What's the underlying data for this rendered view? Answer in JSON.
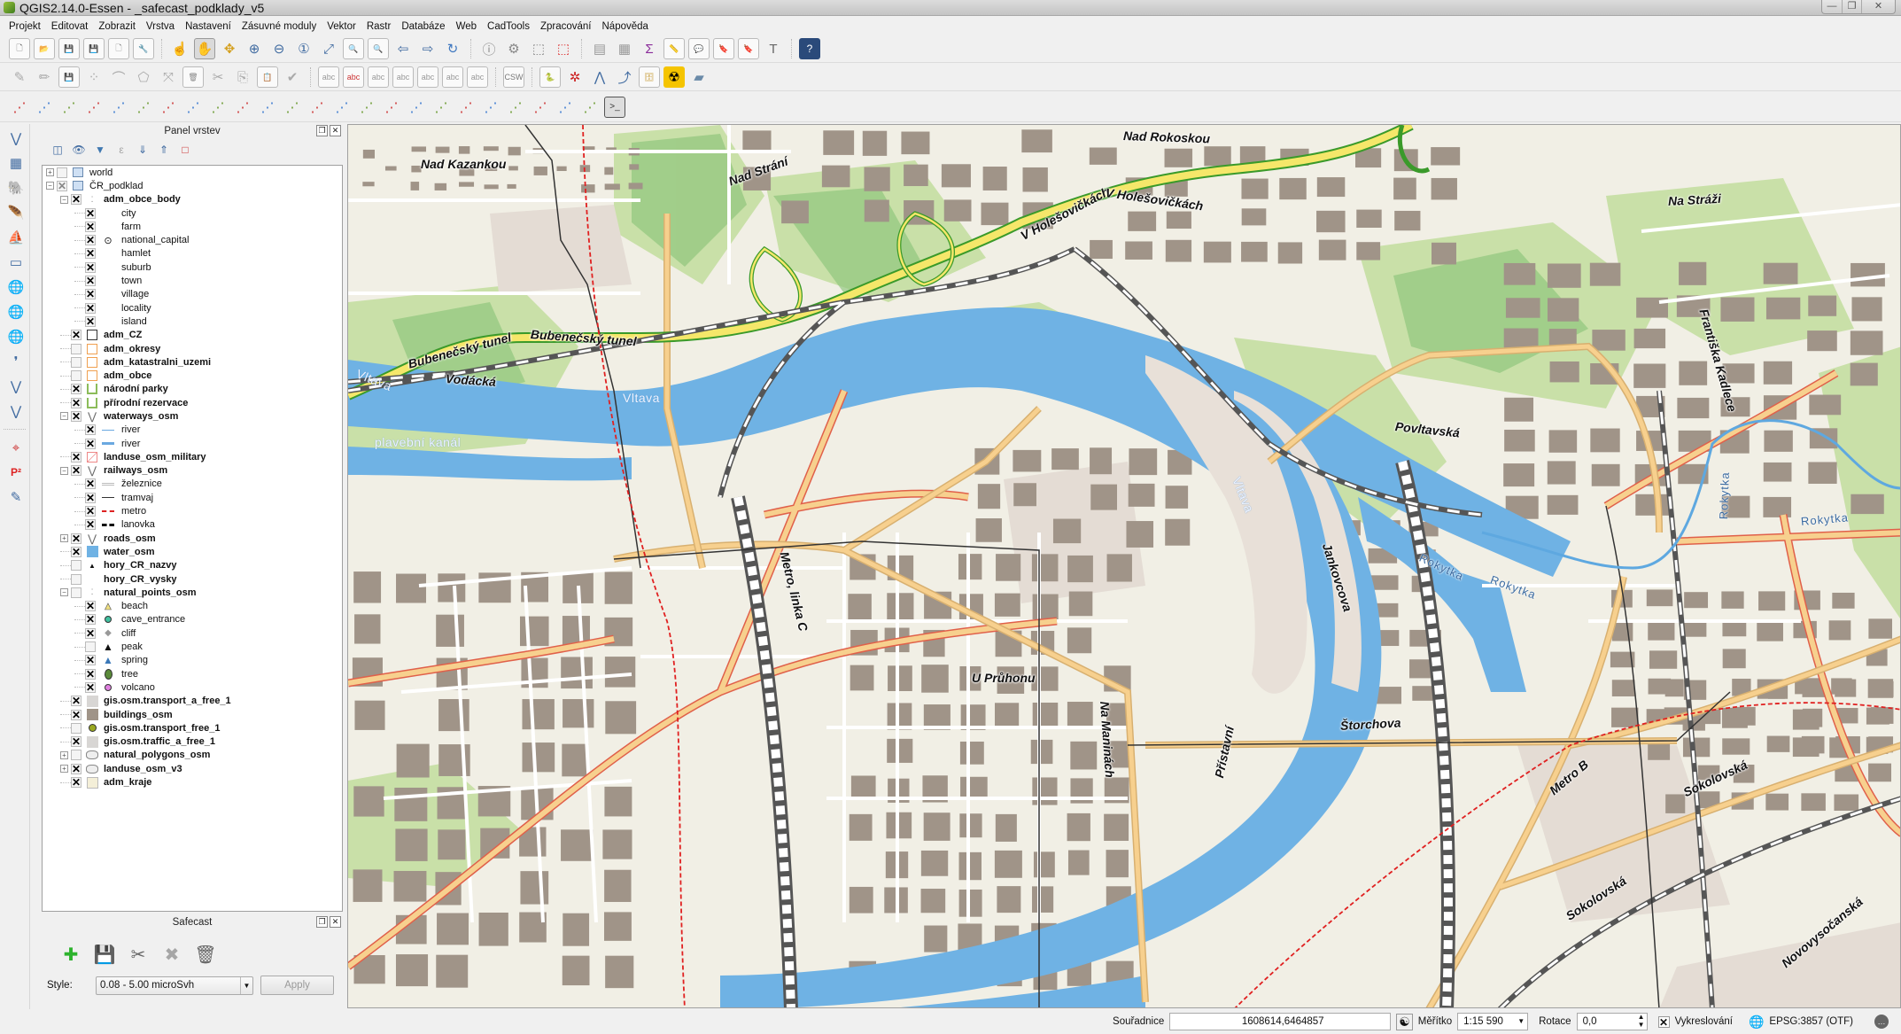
{
  "window": {
    "title": "QGIS2.14.0-Essen - _safecast_podklady_v5",
    "controls": [
      "minimize",
      "restore",
      "close"
    ]
  },
  "menu": [
    "Projekt",
    "Editovat",
    "Zobrazit",
    "Vrstva",
    "Nastavení",
    "Zásuvné moduly",
    "Vektor",
    "Rastr",
    "Databáze",
    "Web",
    "CadTools",
    "Zpracování",
    "Nápověda"
  ],
  "toolbars": {
    "row1": [
      "new-project",
      "open-project",
      "save-project",
      "save-as",
      "new-print-composer",
      "composer-manager",
      "|",
      "touch-zoom",
      "pan",
      "pan-to-selection",
      "zoom-in",
      "zoom-out",
      "zoom-native",
      "zoom-full",
      "zoom-to-selection",
      "zoom-to-layer",
      "zoom-last",
      "zoom-next",
      "refresh",
      "|",
      "identify",
      "action",
      "select",
      "deselect",
      "|",
      "open-attribute-table",
      "field-calculator",
      "statistics",
      "measure",
      "map-tips",
      "new-bookmark",
      "show-bookmarks",
      "text-annotation",
      "|",
      "help"
    ],
    "row2": [
      "current-edits",
      "toggle-editing",
      "save-edits",
      "add-point",
      "node-tool",
      "add-feature",
      "move-feature",
      "delete-selected",
      "cut",
      "copy",
      "paste",
      "digitize",
      "|",
      "label-tool",
      "pin-labels",
      "show-hide-labels",
      "move-label",
      "rotate-label",
      "change-label",
      "label-csw",
      "|",
      "csw",
      "|",
      "python",
      "safecast-tracker",
      "vertex-tool",
      "profile-tool",
      "archive",
      "radiation",
      "polygon"
    ],
    "row3": [
      "cad-1",
      "cad-2",
      "cad-3",
      "cad-4",
      "cad-5",
      "cad-6",
      "cad-7",
      "cad-8",
      "cad-9",
      "cad-10",
      "cad-11",
      "cad-12",
      "cad-13",
      "cad-14",
      "cad-15",
      "cad-16",
      "cad-17",
      "cad-18",
      "cad-19",
      "cad-20",
      "cad-21",
      "cad-22",
      "cad-23",
      "cad-24",
      "python-console"
    ]
  },
  "left_toolbar": [
    "add-vector-layer",
    "add-raster-layer",
    "add-postgis-layer",
    "add-spatialite-layer",
    "add-mssql-layer",
    "add-oracle-layer",
    "add-wms-layer",
    "add-wcs-layer",
    "add-wfs-layer",
    "add-delimited-text",
    "add-virtual-layer",
    "new-shapefile",
    "|",
    "coordinate-capture",
    "p2-plugin",
    "edit-plugin"
  ],
  "layer_panel": {
    "title": "Panel vrstev",
    "layers": [
      {
        "name": "world",
        "level": 0,
        "expand": "+",
        "checked": false,
        "group": false,
        "sym": "group"
      },
      {
        "name": "ČR_podklad",
        "level": 0,
        "expand": "-",
        "checked": "partial",
        "group": false,
        "sym": "group"
      },
      {
        "name": "adm_obce_body",
        "level": 1,
        "expand": "-",
        "checked": true,
        "group": true,
        "sym": "points"
      },
      {
        "name": "city",
        "level": 2,
        "checked": true,
        "sym": ""
      },
      {
        "name": "farm",
        "level": 2,
        "checked": true,
        "sym": ""
      },
      {
        "name": "national_capital",
        "level": 2,
        "checked": true,
        "sym": "capital"
      },
      {
        "name": "hamlet",
        "level": 2,
        "checked": true,
        "sym": ""
      },
      {
        "name": "suburb",
        "level": 2,
        "checked": true,
        "sym": ""
      },
      {
        "name": "town",
        "level": 2,
        "checked": true,
        "sym": ""
      },
      {
        "name": "village",
        "level": 2,
        "checked": true,
        "sym": ""
      },
      {
        "name": "locality",
        "level": 2,
        "checked": true,
        "sym": ""
      },
      {
        "name": "island",
        "level": 2,
        "checked": true,
        "sym": ""
      },
      {
        "name": "adm_CZ",
        "level": 1,
        "checked": true,
        "group": true,
        "sym": "box-black"
      },
      {
        "name": "adm_okresy",
        "level": 1,
        "checked": false,
        "group": true,
        "sym": "box-orange"
      },
      {
        "name": "adm_katastralni_uzemi",
        "level": 1,
        "checked": false,
        "group": true,
        "sym": "box-orange"
      },
      {
        "name": "adm_obce",
        "level": 1,
        "checked": false,
        "group": true,
        "sym": "box-orange"
      },
      {
        "name": "národní parky",
        "level": 1,
        "checked": true,
        "group": true,
        "sym": "box-green"
      },
      {
        "name": "přírodní rezervace",
        "level": 1,
        "checked": true,
        "group": true,
        "sym": "box-green"
      },
      {
        "name": "waterways_osm",
        "level": 1,
        "expand": "-",
        "checked": true,
        "group": true,
        "sym": "line-rule"
      },
      {
        "name": "river",
        "level": 2,
        "checked": true,
        "sym": "line-blue-thin"
      },
      {
        "name": "river",
        "level": 2,
        "checked": true,
        "sym": "line-blue-thick"
      },
      {
        "name": "landuse_osm_military",
        "level": 1,
        "checked": true,
        "group": true,
        "sym": "box-hatch"
      },
      {
        "name": "railways_osm",
        "level": 1,
        "expand": "-",
        "checked": true,
        "group": true,
        "sym": "line-rule"
      },
      {
        "name": "železnice",
        "level": 2,
        "checked": true,
        "sym": "line-grey"
      },
      {
        "name": "tramvaj",
        "level": 2,
        "checked": true,
        "sym": "line-tram"
      },
      {
        "name": "metro",
        "level": 2,
        "checked": true,
        "sym": "line-red-dash"
      },
      {
        "name": "lanovka",
        "level": 2,
        "checked": true,
        "sym": "line-black-dash"
      },
      {
        "name": "roads_osm",
        "level": 1,
        "expand": "+",
        "checked": true,
        "group": true,
        "sym": "line-rule"
      },
      {
        "name": "water_osm",
        "level": 1,
        "checked": true,
        "group": true,
        "sym": "fill-blue"
      },
      {
        "name": "hory_CR_nazvy",
        "level": 1,
        "checked": false,
        "group": true,
        "sym": "triangle-small"
      },
      {
        "name": "hory_CR_vysky",
        "level": 1,
        "checked": false,
        "group": true,
        "sym": ""
      },
      {
        "name": "natural_points_osm",
        "level": 1,
        "expand": "-",
        "checked": false,
        "group": true,
        "sym": "points"
      },
      {
        "name": "beach",
        "level": 2,
        "checked": true,
        "sym": "tri-yellow"
      },
      {
        "name": "cave_entrance",
        "level": 2,
        "checked": true,
        "sym": "dot-teal"
      },
      {
        "name": "cliff",
        "level": 2,
        "checked": true,
        "sym": "diamond-grey"
      },
      {
        "name": "peak",
        "level": 2,
        "checked": false,
        "sym": "tri-black"
      },
      {
        "name": "spring",
        "level": 2,
        "checked": true,
        "sym": "tri-blue"
      },
      {
        "name": "tree",
        "level": 2,
        "checked": true,
        "sym": "ellipse-green"
      },
      {
        "name": "volcano",
        "level": 2,
        "checked": true,
        "sym": "dot-pink"
      },
      {
        "name": "gis.osm.transport_a_free_1",
        "level": 1,
        "checked": true,
        "group": true,
        "sym": "fill-lightgrey"
      },
      {
        "name": "buildings_osm",
        "level": 1,
        "checked": true,
        "group": true,
        "sym": "fill-brown"
      },
      {
        "name": "gis.osm.transport_free_1",
        "level": 1,
        "checked": false,
        "group": true,
        "sym": "dot-olive"
      },
      {
        "name": "gis.osm.traffic_a_free_1",
        "level": 1,
        "checked": true,
        "group": true,
        "sym": "fill-lightgrey"
      },
      {
        "name": "natural_polygons_osm",
        "level": 1,
        "expand": "+",
        "checked": false,
        "group": true,
        "sym": "poly-rule"
      },
      {
        "name": "landuse_osm_v3",
        "level": 1,
        "expand": "+",
        "checked": true,
        "group": true,
        "sym": "poly-rule"
      },
      {
        "name": "adm_kraje",
        "level": 1,
        "checked": true,
        "group": true,
        "sym": "fill-cream"
      }
    ]
  },
  "safecast": {
    "title": "Safecast",
    "tools": [
      "import-log",
      "save-log",
      "cut-log",
      "remove-cut",
      "delete-log"
    ],
    "style_label": "Style:",
    "style_value": "0.08 - 5.00 microSvh",
    "apply_label": "Apply"
  },
  "map": {
    "street_labels": [
      "Nad Kazankou",
      "Nad Strání",
      "Nad Rokoskou",
      "V Holešovičkách",
      "V Holešovičkách",
      "Na Stráži",
      "Bubenečský tunel",
      "Bubenečský tunel",
      "Vodácká",
      "Povltavská",
      "Františka Kadlece",
      "Metro, linka C",
      "Jankovcova",
      "U Průhonu",
      "Na Maninách",
      "Přístavní",
      "Štorchova",
      "Metro B",
      "Sokolovská",
      "Sokolovská",
      "Novovysočanská"
    ],
    "water_labels": [
      "Vltava",
      "Vltava",
      "Vltava",
      "plavební kanál"
    ],
    "river_labels": [
      "Rokytka",
      "Rokytka",
      "Rokytka",
      "Rokytka"
    ]
  },
  "statusbar": {
    "coord_label": "Souřadnice",
    "coord_value": "1608614,6464857",
    "scale_label": "Měřítko",
    "scale_value": "1:15 590",
    "rotation_label": "Rotace",
    "rotation_value": "0,0",
    "render_label": "Vykreslování",
    "render_checked": true,
    "crs": "EPSG:3857 (OTF)"
  },
  "colors": {
    "water": "#6fb2e4",
    "land": "#f1efe5",
    "building": "#a09488",
    "park": "#c9e0a8",
    "forest": "#8cc47a",
    "motorway": "#f5e76a",
    "motorway_casing": "#3a9a2a",
    "primary": "#f7d08e",
    "primary_casing": "#e0604a",
    "metro": "#e02020"
  }
}
